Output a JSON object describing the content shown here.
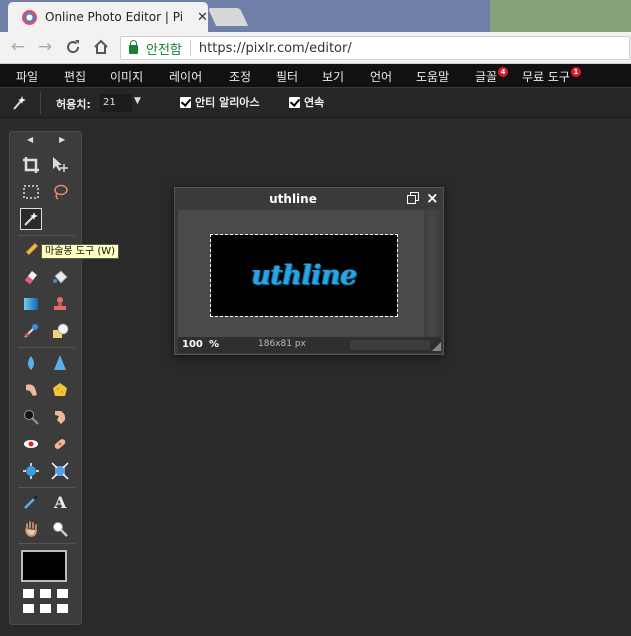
{
  "browser": {
    "tab_title": "Online Photo Editor | Pi",
    "tab_close": "✕",
    "secure_label": "안전함",
    "url": "https://pixlr.com/editor/"
  },
  "menu": {
    "items": [
      {
        "label": "파일"
      },
      {
        "label": "편집"
      },
      {
        "label": "이미지"
      },
      {
        "label": "레이어"
      },
      {
        "label": "조정"
      },
      {
        "label": "필터"
      },
      {
        "label": "보기"
      },
      {
        "label": "언어"
      },
      {
        "label": "도움말"
      },
      {
        "label": "글꼴",
        "badge": "4"
      },
      {
        "label": "무료 도구",
        "badge": "1"
      }
    ]
  },
  "options": {
    "tolerance_label": "허용치:",
    "tolerance_value": "21",
    "antialias_label": "안티 알리아스",
    "contiguous_label": "연속"
  },
  "tools": {
    "tooltip": "마술봉 도구 (W)",
    "active": "magic-wand",
    "foreground_color": "#000000"
  },
  "document": {
    "title": "uthline",
    "image_text": "uthline",
    "image_text_color": "#2aa4e0",
    "zoom": "100",
    "zoom_unit": "%",
    "size": "186x81 px"
  }
}
